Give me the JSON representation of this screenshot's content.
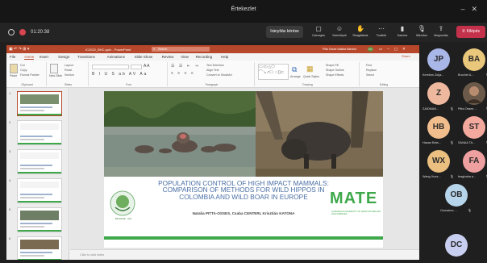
{
  "teams": {
    "window_title": "Értekezlet",
    "timer": "01:20:38",
    "join_label": "Irányítás kérése",
    "leave_label": "Kilépés",
    "toolbar": [
      {
        "label": "Csevegés",
        "icon": "chat-icon"
      },
      {
        "label": "Személyek",
        "icon": "people-icon"
      },
      {
        "label": "Reagálások",
        "icon": "reactions-icon"
      },
      {
        "label": "További",
        "icon": "more-icon"
      },
      {
        "label": "Kamera",
        "icon": "camera-icon"
      },
      {
        "label": "Mikrofon",
        "icon": "mic-icon"
      },
      {
        "label": "Megosztás",
        "icon": "share-icon"
      }
    ]
  },
  "powerpoint": {
    "title": "IC2022_BHC.pptx - PowerPoint",
    "search_placeholder": "Search",
    "account": "Pitta Osses Natalia Marcela",
    "account_initials": "PO",
    "share_label": "Share",
    "tabs": [
      "File",
      "Home",
      "Insert",
      "Design",
      "Transitions",
      "Animations",
      "Slide Show",
      "Review",
      "View",
      "Recording",
      "Help"
    ],
    "ribbon_groups": [
      "Clipboard",
      "Slides",
      "Font",
      "Paragraph",
      "Drawing",
      "Editing"
    ],
    "ribbon_items": {
      "paste": "Paste",
      "cut": "Cut",
      "copy": "Copy",
      "format_painter": "Format Painter",
      "new_slide": "New Slide",
      "layout": "Layout",
      "reset": "Reset",
      "section": "Section",
      "find": "Find",
      "replace": "Replace",
      "select": "Select",
      "arrange": "Arrange",
      "quick_styles": "Quick Styles",
      "shape_fill": "Shape Fill",
      "shape_outline": "Shape Outline",
      "shape_effects": "Shape Effects",
      "text_direction": "Text Direction",
      "align_text": "Align Text",
      "convert_smartart": "Convert to SmartArt"
    },
    "slide_numbers": [
      "1",
      "2",
      "3",
      "4",
      "5",
      "6"
    ],
    "notes_placeholder": "Click to add notes"
  },
  "slide": {
    "title_lines": [
      "POPULATION CONTROL OF HIGH IMPACT MAMMALS:",
      "COMPARISON OF METHODS FOR WILD HIPPOS IN",
      "COLOMBIA AND WILD BOAR IN EUROPE"
    ],
    "authors": "Natalia PITTA-OSSES, Csaba CENTERI, Krisztián KATONA",
    "logo_mate": "MATE",
    "logo_mate_sub": "HUNGARIAN UNIVERSITY OF AGRICULTURE AND LIFE SCIENCES",
    "logo_left_caption": "WILDLIFE · GIS",
    "accent_color": "#3ea84b",
    "title_color": "#4a6fa5"
  },
  "participants": [
    {
      "initials": "JP",
      "name": "Kerekes Zolja...",
      "color": "#a9b6e8",
      "muted": false
    },
    {
      "initials": "BA",
      "name": "Bruchet A...",
      "color": "#e9c77b",
      "muted": true
    },
    {
      "initials": "Z",
      "name": "ZAIDMAN...",
      "color": "#eeb89f",
      "muted": true
    },
    {
      "initials": "",
      "name": "Pitta Osses ...",
      "color": "#6b5a4a",
      "muted": true
    },
    {
      "initials": "HB",
      "name": "Hasan Bela...",
      "color": "#f2bd8c",
      "muted": true
    },
    {
      "initials": "ST",
      "name": "SANAA TA...",
      "color": "#f4a99e",
      "muted": true
    },
    {
      "initials": "WX",
      "name": "Wang Xuez...",
      "color": "#eabf80",
      "muted": true
    },
    {
      "initials": "FA",
      "name": "fnaghaba a...",
      "color": "#ee9f9f",
      "muted": true
    },
    {
      "initials": "OB",
      "name": "Oumaima ...",
      "color": "#b6d4ea",
      "muted": true
    },
    {
      "initials": "DC",
      "name": "",
      "color": "#c7cef0",
      "muted": false
    }
  ]
}
